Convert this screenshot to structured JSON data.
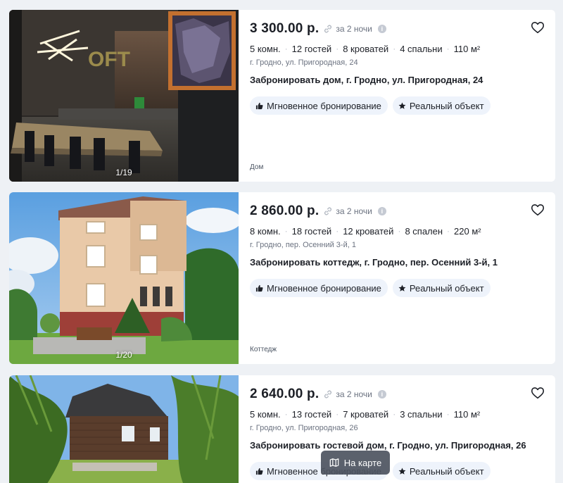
{
  "listings": [
    {
      "price": "3 300.00 р.",
      "nights": "за 2 ночи",
      "specs": [
        "5 комн.",
        "12 гостей",
        "8 кроватей",
        "4 спальни",
        "110 м²"
      ],
      "address": "г. Гродно, ул. Пригородная, 24",
      "title": "Забронировать дом, г. Гродно, ул. Пригородная, 24",
      "badges": [
        "Мгновенное бронирование",
        "Реальный объект"
      ],
      "type": "Дом",
      "photo_counter": "1/19",
      "photo_icon": "interior-loft-kitchen"
    },
    {
      "price": "2 860.00 р.",
      "nights": "за 2 ночи",
      "specs": [
        "8 комн.",
        "18 гостей",
        "12 кроватей",
        "8 спален",
        "220 м²"
      ],
      "address": "г. Гродно, пер. Осенний 3-й, 1",
      "title": "Забронировать коттедж, г. Гродно, пер. Осенний 3-й, 1",
      "badges": [
        "Мгновенное бронирование",
        "Реальный объект"
      ],
      "type": "Коттедж",
      "photo_counter": "1/20",
      "photo_icon": "cottage-exterior"
    },
    {
      "price": "2 640.00 р.",
      "nights": "за 2 ночи",
      "specs": [
        "5 комн.",
        "13 гостей",
        "7 кроватей",
        "3 спальни",
        "110 м²"
      ],
      "address": "г. Гродно, ул. Пригородная, 26",
      "title": "Забронировать гостевой дом, г. Гродно, ул. Пригородная, 26",
      "badges": [
        "Мгновенное бронирование",
        "Реальный объект"
      ],
      "type": "",
      "photo_counter": "",
      "photo_icon": "wooden-guest-house"
    }
  ],
  "map_button": {
    "label": "На карте",
    "icon": "map-icon"
  },
  "colors": {
    "background": "#eef1f5",
    "badge_bg": "#eef3fb",
    "muted_text": "#6b7280",
    "map_button_bg": "#4d5460"
  }
}
